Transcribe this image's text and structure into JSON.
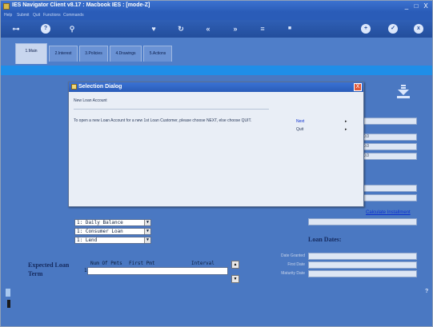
{
  "window": {
    "title": "IES Navigator Client v8.17 : Macbook IES :      [mode-Z]",
    "minimize": "_",
    "maximize": "□",
    "close": "X"
  },
  "menu": [
    "Help",
    "Submit",
    "Quit",
    "Functions",
    "Commands"
  ],
  "toolbar": {
    "icons": [
      {
        "name": "key-icon",
        "glyph": "⊶"
      },
      {
        "name": "help-icon",
        "glyph": "?"
      },
      {
        "name": "search-icon",
        "glyph": "⚲"
      },
      {
        "name": "heart-icon",
        "glyph": "♥"
      },
      {
        "name": "refresh-icon",
        "glyph": "↻"
      },
      {
        "name": "rewind-icon",
        "glyph": "«"
      },
      {
        "name": "forward-icon",
        "glyph": "»"
      },
      {
        "name": "edit-icon",
        "glyph": "≡"
      },
      {
        "name": "trash-icon",
        "glyph": "■"
      },
      {
        "name": "add-icon",
        "glyph": "+"
      },
      {
        "name": "check-icon",
        "glyph": "✓"
      },
      {
        "name": "cancel-icon",
        "glyph": "x"
      }
    ]
  },
  "tabs": [
    {
      "label": "1.Main",
      "active": true
    },
    {
      "label": "2.Interest",
      "active": false
    },
    {
      "label": "3.Policies",
      "active": false
    },
    {
      "label": "4.Drawings",
      "active": false
    },
    {
      "label": "5.Actions",
      "active": false
    }
  ],
  "form": {
    "combo_1": "1: Daily Balance",
    "combo_2": "1: Consumer Loan",
    "combo_3": "1: Lend",
    "calc_link": "Calculate Installment",
    "loan_dates_heading": "Loan Dates:",
    "date_labels": [
      "Date Granted",
      "First Date",
      "Maturity Date"
    ],
    "field_value_1": "0.0",
    "field_value_2": "0.0",
    "field_value_3": "0.0",
    "expected_term_line1": "Expected Loan",
    "expected_term_line2": "Term",
    "grid_headers": [
      "Num Of Pmts",
      "First Pmt",
      "Interval"
    ],
    "grid_row_no": "1"
  },
  "dialog": {
    "title": "Selection Dialog",
    "close": "X",
    "header": "New Loan Account",
    "message": "To open a new Loan Account for a new 1st Loan Customer, please choose NEXT, else choose QUIT.",
    "options": [
      {
        "label": "Next",
        "arrow": "▸"
      },
      {
        "label": "Quit",
        "arrow": "▸"
      }
    ]
  },
  "colors": {
    "background": "#4a78c2",
    "title_bar": "#2a5cb8",
    "accent_bar": "#1f8ee8",
    "link": "#0b2fd0"
  }
}
